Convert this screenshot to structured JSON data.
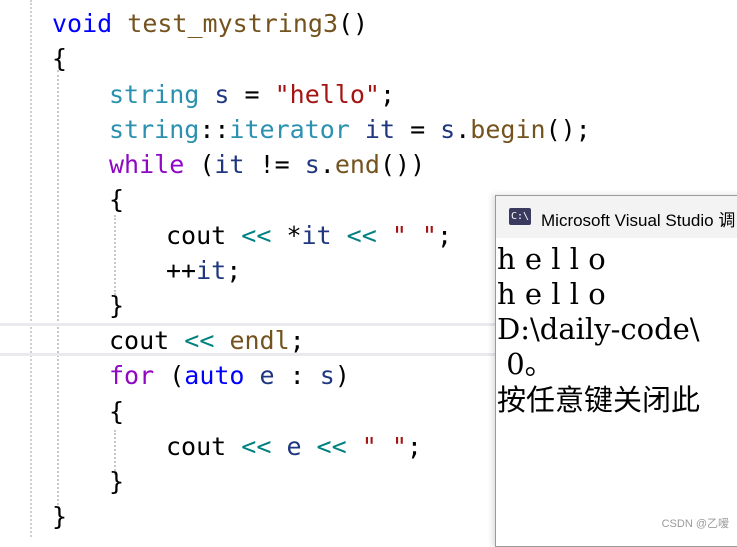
{
  "code": {
    "func_ret": "void",
    "func_name": "test_mystring3",
    "func_parens": "()",
    "brace_open": "{",
    "brace_close": "}",
    "l3_type": "string",
    "l3_var": "s",
    "l3_eq": " = ",
    "l3_str": "\"hello\"",
    "l3_semi": ";",
    "l4_type": "string",
    "l4_scope": "::",
    "l4_iter": "iterator",
    "l4_var": "it",
    "l4_eq": " = ",
    "l4_obj": "s",
    "l4_dot": ".",
    "l4_fn": "begin",
    "l4_tail": "();",
    "l5_kw": "while",
    "l5_open": " (",
    "l5_var": "it",
    "l5_op": " != ",
    "l5_obj": "s",
    "l5_dot": ".",
    "l5_fn": "end",
    "l5_tail": "())",
    "l7_cout": "cout",
    "l7_shl1": " << ",
    "l7_deref": "*",
    "l7_var": "it",
    "l7_shl2": " << ",
    "l7_str": "\" \"",
    "l7_semi": ";",
    "l8_inc": "++",
    "l8_var": "it",
    "l8_semi": ";",
    "l10_cout": "cout",
    "l10_shl": " << ",
    "l10_endl": "endl",
    "l10_semi": ";",
    "l11_kw": "for",
    "l11_open": " (",
    "l11_auto": "auto",
    "l11_var": "e",
    "l11_colon": " : ",
    "l11_obj": "s",
    "l11_close": ")",
    "l13_cout": "cout",
    "l13_shl1": " << ",
    "l13_var": "e",
    "l13_shl2": " << ",
    "l13_str": "\" \"",
    "l13_semi": ";"
  },
  "console": {
    "title": "Microsoft Visual Studio 调",
    "icon_name": "console-app-icon",
    "icon_text": "C:\\",
    "lines": [
      "h e l l o",
      "h e l l o",
      "D:\\daily-code\\",
      " 0。",
      "按任意键关闭此"
    ]
  },
  "watermark": "CSDN @乙嗳"
}
